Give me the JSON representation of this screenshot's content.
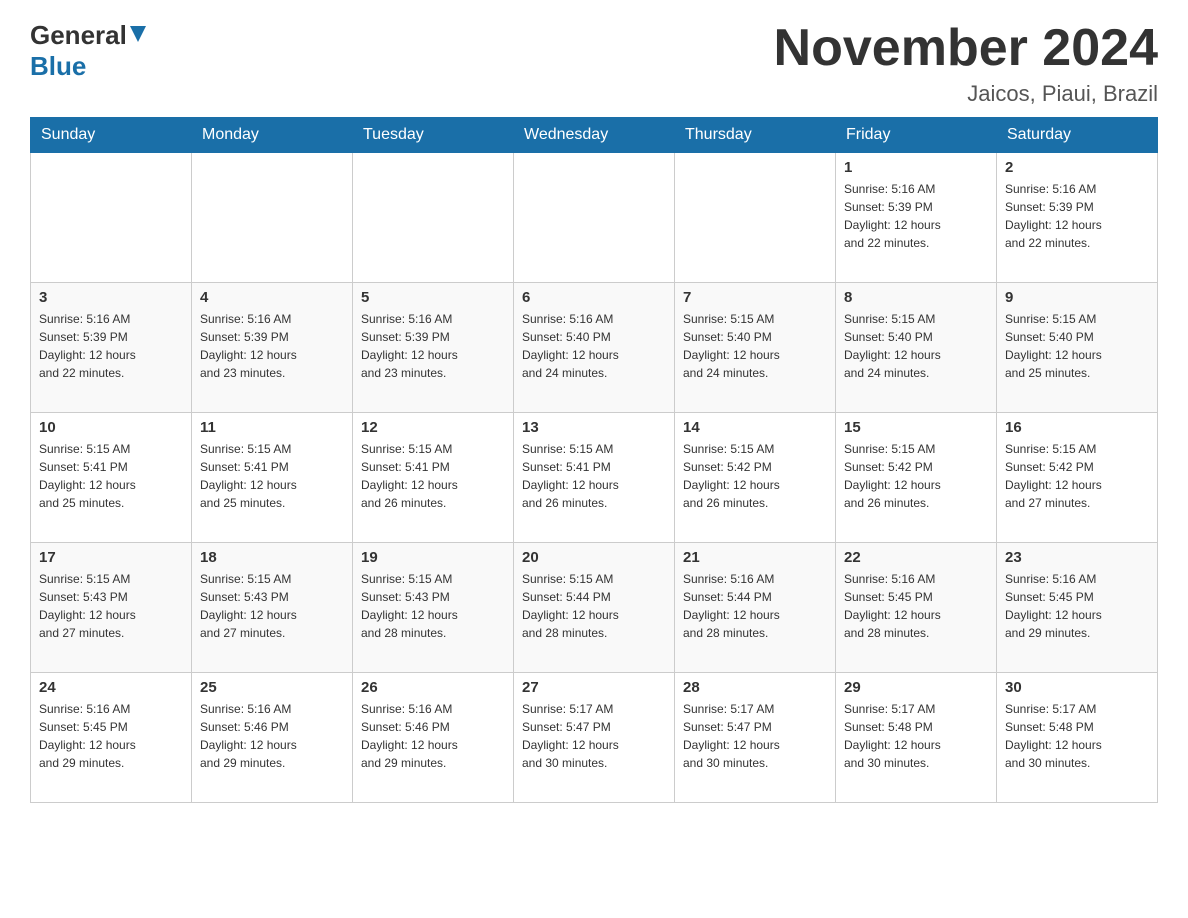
{
  "header": {
    "logo_general": "General",
    "logo_blue": "Blue",
    "title": "November 2024",
    "subtitle": "Jaicos, Piaui, Brazil"
  },
  "weekdays": [
    "Sunday",
    "Monday",
    "Tuesday",
    "Wednesday",
    "Thursday",
    "Friday",
    "Saturday"
  ],
  "weeks": [
    {
      "days": [
        {
          "number": "",
          "info": ""
        },
        {
          "number": "",
          "info": ""
        },
        {
          "number": "",
          "info": ""
        },
        {
          "number": "",
          "info": ""
        },
        {
          "number": "",
          "info": ""
        },
        {
          "number": "1",
          "info": "Sunrise: 5:16 AM\nSunset: 5:39 PM\nDaylight: 12 hours\nand 22 minutes."
        },
        {
          "number": "2",
          "info": "Sunrise: 5:16 AM\nSunset: 5:39 PM\nDaylight: 12 hours\nand 22 minutes."
        }
      ]
    },
    {
      "days": [
        {
          "number": "3",
          "info": "Sunrise: 5:16 AM\nSunset: 5:39 PM\nDaylight: 12 hours\nand 22 minutes."
        },
        {
          "number": "4",
          "info": "Sunrise: 5:16 AM\nSunset: 5:39 PM\nDaylight: 12 hours\nand 23 minutes."
        },
        {
          "number": "5",
          "info": "Sunrise: 5:16 AM\nSunset: 5:39 PM\nDaylight: 12 hours\nand 23 minutes."
        },
        {
          "number": "6",
          "info": "Sunrise: 5:16 AM\nSunset: 5:40 PM\nDaylight: 12 hours\nand 24 minutes."
        },
        {
          "number": "7",
          "info": "Sunrise: 5:15 AM\nSunset: 5:40 PM\nDaylight: 12 hours\nand 24 minutes."
        },
        {
          "number": "8",
          "info": "Sunrise: 5:15 AM\nSunset: 5:40 PM\nDaylight: 12 hours\nand 24 minutes."
        },
        {
          "number": "9",
          "info": "Sunrise: 5:15 AM\nSunset: 5:40 PM\nDaylight: 12 hours\nand 25 minutes."
        }
      ]
    },
    {
      "days": [
        {
          "number": "10",
          "info": "Sunrise: 5:15 AM\nSunset: 5:41 PM\nDaylight: 12 hours\nand 25 minutes."
        },
        {
          "number": "11",
          "info": "Sunrise: 5:15 AM\nSunset: 5:41 PM\nDaylight: 12 hours\nand 25 minutes."
        },
        {
          "number": "12",
          "info": "Sunrise: 5:15 AM\nSunset: 5:41 PM\nDaylight: 12 hours\nand 26 minutes."
        },
        {
          "number": "13",
          "info": "Sunrise: 5:15 AM\nSunset: 5:41 PM\nDaylight: 12 hours\nand 26 minutes."
        },
        {
          "number": "14",
          "info": "Sunrise: 5:15 AM\nSunset: 5:42 PM\nDaylight: 12 hours\nand 26 minutes."
        },
        {
          "number": "15",
          "info": "Sunrise: 5:15 AM\nSunset: 5:42 PM\nDaylight: 12 hours\nand 26 minutes."
        },
        {
          "number": "16",
          "info": "Sunrise: 5:15 AM\nSunset: 5:42 PM\nDaylight: 12 hours\nand 27 minutes."
        }
      ]
    },
    {
      "days": [
        {
          "number": "17",
          "info": "Sunrise: 5:15 AM\nSunset: 5:43 PM\nDaylight: 12 hours\nand 27 minutes."
        },
        {
          "number": "18",
          "info": "Sunrise: 5:15 AM\nSunset: 5:43 PM\nDaylight: 12 hours\nand 27 minutes."
        },
        {
          "number": "19",
          "info": "Sunrise: 5:15 AM\nSunset: 5:43 PM\nDaylight: 12 hours\nand 28 minutes."
        },
        {
          "number": "20",
          "info": "Sunrise: 5:15 AM\nSunset: 5:44 PM\nDaylight: 12 hours\nand 28 minutes."
        },
        {
          "number": "21",
          "info": "Sunrise: 5:16 AM\nSunset: 5:44 PM\nDaylight: 12 hours\nand 28 minutes."
        },
        {
          "number": "22",
          "info": "Sunrise: 5:16 AM\nSunset: 5:45 PM\nDaylight: 12 hours\nand 28 minutes."
        },
        {
          "number": "23",
          "info": "Sunrise: 5:16 AM\nSunset: 5:45 PM\nDaylight: 12 hours\nand 29 minutes."
        }
      ]
    },
    {
      "days": [
        {
          "number": "24",
          "info": "Sunrise: 5:16 AM\nSunset: 5:45 PM\nDaylight: 12 hours\nand 29 minutes."
        },
        {
          "number": "25",
          "info": "Sunrise: 5:16 AM\nSunset: 5:46 PM\nDaylight: 12 hours\nand 29 minutes."
        },
        {
          "number": "26",
          "info": "Sunrise: 5:16 AM\nSunset: 5:46 PM\nDaylight: 12 hours\nand 29 minutes."
        },
        {
          "number": "27",
          "info": "Sunrise: 5:17 AM\nSunset: 5:47 PM\nDaylight: 12 hours\nand 30 minutes."
        },
        {
          "number": "28",
          "info": "Sunrise: 5:17 AM\nSunset: 5:47 PM\nDaylight: 12 hours\nand 30 minutes."
        },
        {
          "number": "29",
          "info": "Sunrise: 5:17 AM\nSunset: 5:48 PM\nDaylight: 12 hours\nand 30 minutes."
        },
        {
          "number": "30",
          "info": "Sunrise: 5:17 AM\nSunset: 5:48 PM\nDaylight: 12 hours\nand 30 minutes."
        }
      ]
    }
  ]
}
